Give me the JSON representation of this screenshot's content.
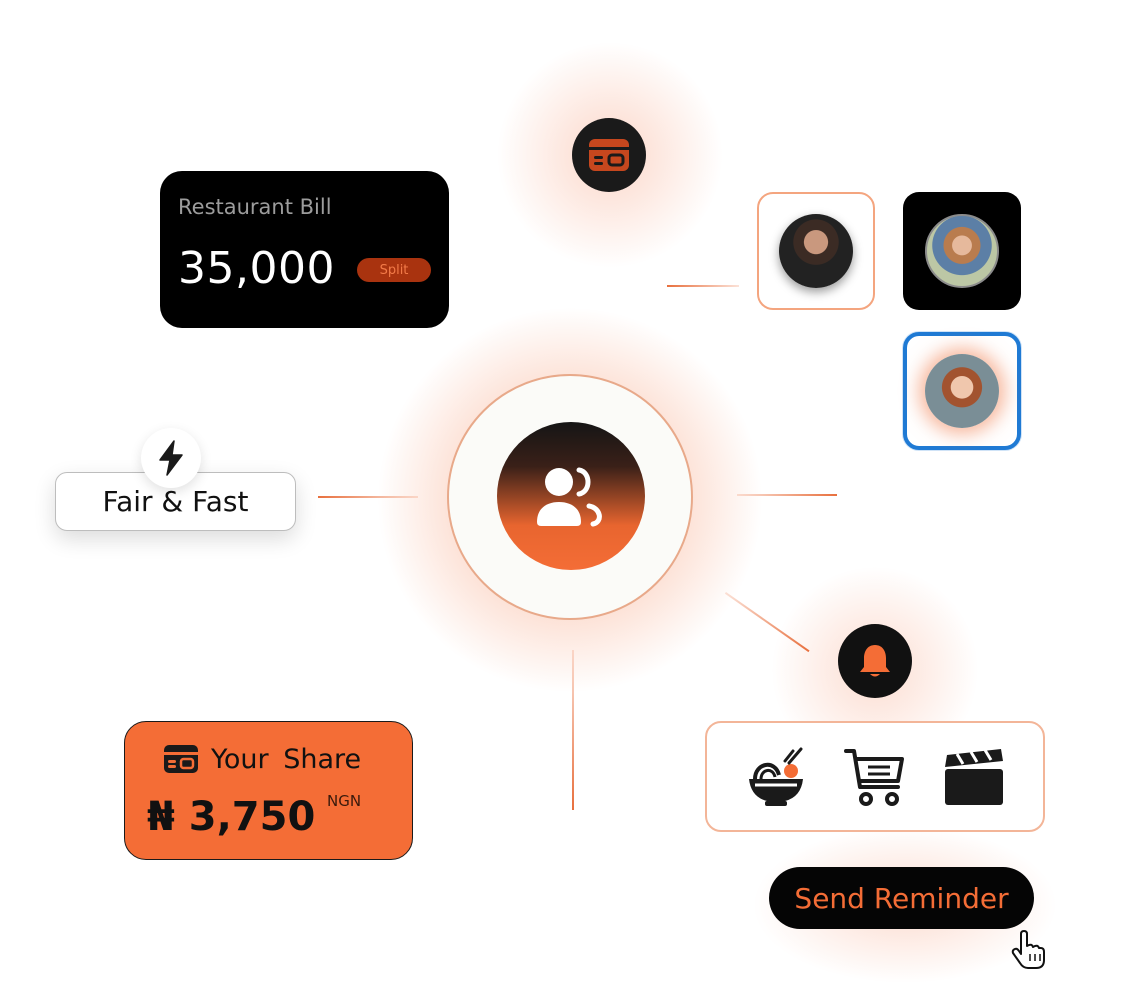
{
  "bill_card": {
    "title": "Restaurant Bill",
    "amount": "35,000",
    "split_label": "Split"
  },
  "badge": {
    "label": "Fair & Fast"
  },
  "share_card": {
    "title": "Your  Share",
    "amount": "₦ 3,750",
    "currency": "NGN"
  },
  "categories": {
    "items": [
      "food-bowl-icon",
      "shopping-cart-icon",
      "clapperboard-icon"
    ]
  },
  "reminder": {
    "label": "Send Reminder"
  },
  "colors": {
    "accent": "#f46d36",
    "dark": "#050505",
    "highlight_border": "#1f7ad4"
  }
}
